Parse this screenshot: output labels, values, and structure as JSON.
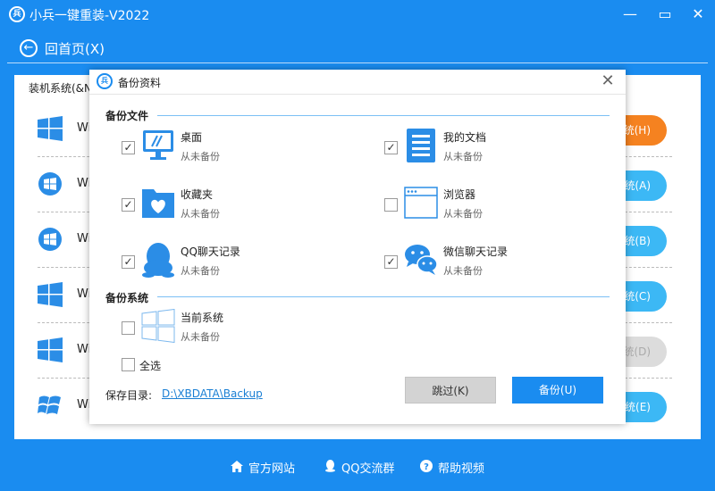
{
  "app": {
    "title": "小兵一键重装-V2022",
    "logo_text": "兵",
    "minimize": "—",
    "maximize": "▭",
    "close": "✕"
  },
  "header": {
    "back_label": "回首页(X)",
    "back_icon": "←"
  },
  "panel": {
    "title": "装机系统(&N)",
    "rows": [
      {
        "name": "Wi",
        "button": "统(H)",
        "style": "orange",
        "icon": "windows-10-icon"
      },
      {
        "name": "Wi",
        "button": "统(A)",
        "style": "blue",
        "icon": "windows-7-icon"
      },
      {
        "name": "Wi",
        "button": "统(B)",
        "style": "blue",
        "icon": "windows-7-icon"
      },
      {
        "name": "Wi",
        "button": "统(C)",
        "style": "blue",
        "icon": "windows-10-icon"
      },
      {
        "name": "Wi",
        "button": "统(D)",
        "style": "gray",
        "icon": "windows-10-icon"
      },
      {
        "name": "Wi",
        "button": "统(E)",
        "style": "blue",
        "icon": "windows-xp-icon"
      }
    ]
  },
  "footer": {
    "official_site": "官方网站",
    "qq_group": "QQ交流群",
    "help_video": "帮助视频"
  },
  "dialog": {
    "title": "备份资料",
    "close": "✕",
    "section_files": "备份文件",
    "section_system": "备份系统",
    "items": {
      "desktop": {
        "label": "桌面",
        "status": "从未备份",
        "checked": true
      },
      "documents": {
        "label": "我的文档",
        "status": "从未备份",
        "checked": true
      },
      "favorites": {
        "label": "收藏夹",
        "status": "从未备份",
        "checked": true
      },
      "browser": {
        "label": "浏览器",
        "status": "从未备份",
        "checked": false
      },
      "qq_chat": {
        "label": "QQ聊天记录",
        "status": "从未备份",
        "checked": true
      },
      "wechat_chat": {
        "label": "微信聊天记录",
        "status": "从未备份",
        "checked": true
      },
      "current_system": {
        "label": "当前系统",
        "status": "从未备份",
        "checked": false
      }
    },
    "select_all": {
      "label": "全选",
      "checked": false
    },
    "save_dir_label": "保存目录:",
    "save_dir_path": "D:\\XBDATA\\Backup",
    "skip_button": "跳过(K)",
    "backup_button": "备份(U)",
    "check_mark": "✓",
    "colors": {
      "accent": "#1a8cf0",
      "orange": "#f58220",
      "icon_blue": "#2b8de6"
    }
  }
}
